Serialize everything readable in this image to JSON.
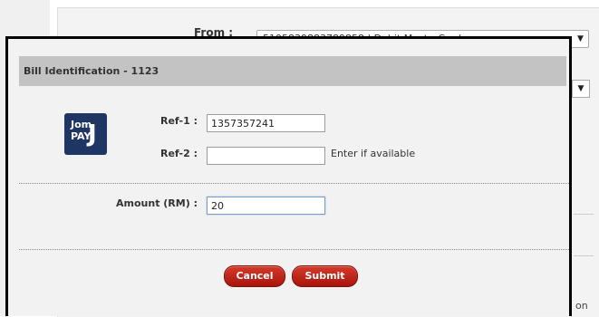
{
  "background": {
    "from_label": "From :",
    "from_value": "5105839883789858 | Debit MasterCard",
    "partial_text": "on"
  },
  "modal": {
    "title": "Bill Identification - 1123",
    "logo": {
      "line1": "Jom",
      "line2": "PAY",
      "letter": "J",
      "icon": "jompay-logo"
    },
    "ref1": {
      "label": "Ref-1 :",
      "value": "1357357241"
    },
    "ref2": {
      "label": "Ref-2 :",
      "value": "",
      "hint": "Enter if available"
    },
    "amount": {
      "label": "Amount (RM) :",
      "value": "20"
    },
    "buttons": {
      "cancel": "Cancel",
      "submit": "Submit"
    }
  },
  "colors": {
    "button_red": "#c0281b",
    "header_gray": "#c3c3c3",
    "logo_navy": "#1f3564"
  }
}
